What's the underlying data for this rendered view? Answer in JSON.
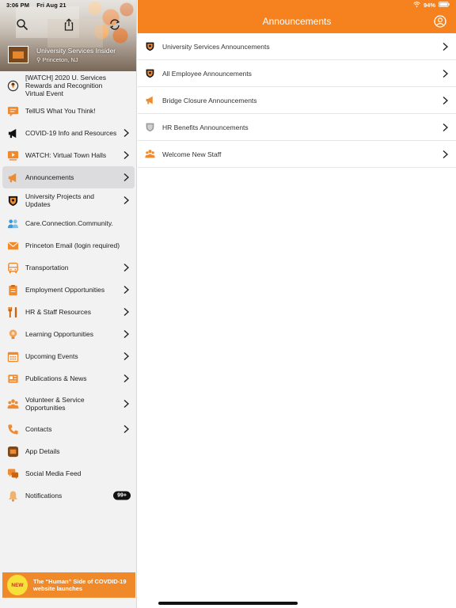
{
  "status_bar": {
    "time": "3:06 PM",
    "date": "Fri Aug 21",
    "battery": "94%"
  },
  "colors": {
    "accent": "#f5821f",
    "sidebar_bg": "#f2f2f3",
    "active_item": "#dcdcde",
    "badge_bg": "#111111"
  },
  "sidebar": {
    "header": {
      "toolbar_icons": [
        "search-icon",
        "share-icon",
        "refresh-icon"
      ],
      "app_name": "University Services Insider",
      "location": "Princeton, NJ"
    },
    "items": [
      {
        "label": "[WATCH] 2020 U. Services Rewards and Recognition Virtual Event",
        "icon": "award-icon",
        "chevron": false
      },
      {
        "label": "TellUS What You Think!",
        "icon": "chat-icon",
        "chevron": false
      },
      {
        "label": "COVID-19 Info and Resources",
        "icon": "megaphone-icon",
        "chevron": true
      },
      {
        "label": "WATCH: Virtual Town Halls",
        "icon": "video-icon",
        "chevron": true
      },
      {
        "label": "Announcements",
        "icon": "megaphone-icon",
        "chevron": true,
        "active": true
      },
      {
        "label": "University Projects and Updates",
        "icon": "shield-icon",
        "chevron": true
      },
      {
        "label": "Care.Connection.Community.",
        "icon": "community-icon",
        "chevron": false
      },
      {
        "label": "Princeton Email (login required)",
        "icon": "mail-icon",
        "chevron": false
      },
      {
        "label": "Transportation",
        "icon": "bus-icon",
        "chevron": true
      },
      {
        "label": "Employment Opportunities",
        "icon": "clipboard-icon",
        "chevron": true
      },
      {
        "label": "HR & Staff Resources",
        "icon": "tools-icon",
        "chevron": true
      },
      {
        "label": "Learning Opportunities",
        "icon": "lightbulb-icon",
        "chevron": true
      },
      {
        "label": "Upcoming Events",
        "icon": "calendar-icon",
        "chevron": true
      },
      {
        "label": "Publications & News",
        "icon": "newspaper-icon",
        "chevron": true
      },
      {
        "label": "Volunteer & Service Opportunities",
        "icon": "volunteer-icon",
        "chevron": true
      },
      {
        "label": "Contacts",
        "icon": "phone-icon",
        "chevron": true
      },
      {
        "label": "App Details",
        "icon": "app-icon",
        "chevron": false
      },
      {
        "label": "Social Media Feed",
        "icon": "social-icon",
        "chevron": false
      },
      {
        "label": "Notifications",
        "icon": "bell-icon",
        "chevron": false,
        "badge": "99+"
      }
    ],
    "promo": {
      "badge": "NEW",
      "text": "The “Human” Side of COVDID-19 website launches"
    }
  },
  "main": {
    "title": "Announcements",
    "list": [
      {
        "label": "University Services Announcements",
        "icon": "shield-icon"
      },
      {
        "label": "All Employee Announcements",
        "icon": "shield-icon"
      },
      {
        "label": "Bridge Closure Announcements",
        "icon": "megaphone-icon"
      },
      {
        "label": "HR Benefits Announcements",
        "icon": "shield-gray-icon"
      },
      {
        "label": "Welcome New Staff",
        "icon": "group-icon"
      }
    ]
  }
}
